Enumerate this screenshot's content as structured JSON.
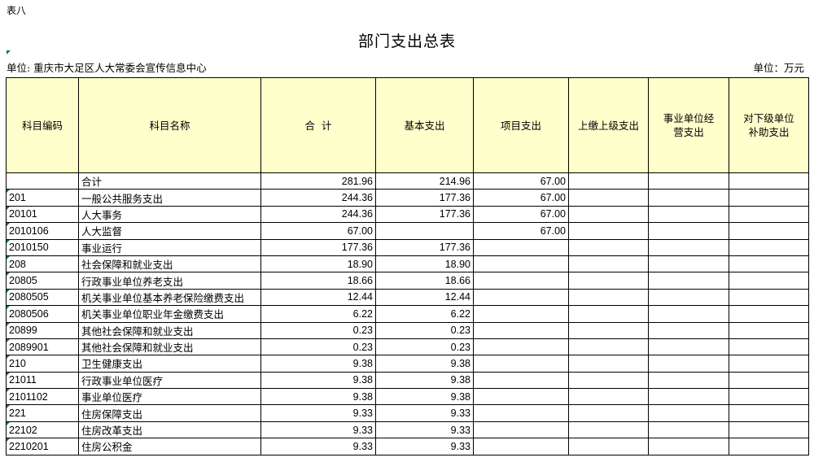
{
  "sheet_label": "表八",
  "title": "部门支出总表",
  "unit_left": "单位:  重庆市大足区人大常委会宣传信息中心",
  "unit_right": "单位：万元",
  "columns": [
    "科目编码",
    "科目名称",
    "合  计",
    "基本支出",
    "项目支出",
    "上缴上级支出",
    "事业单位经营支出",
    "对下级单位补助支出"
  ],
  "rows": [
    {
      "code": "",
      "name": "合计",
      "total": "281.96",
      "basic": "214.96",
      "project": "67.00",
      "upper": "",
      "business": "",
      "subsidy": ""
    },
    {
      "code": "201",
      "name": "一般公共服务支出",
      "total": "244.36",
      "basic": "177.36",
      "project": "67.00",
      "upper": "",
      "business": "",
      "subsidy": ""
    },
    {
      "code": "20101",
      "name": "人大事务",
      "total": "244.36",
      "basic": "177.36",
      "project": "67.00",
      "upper": "",
      "business": "",
      "subsidy": ""
    },
    {
      "code": "2010106",
      "name": "人大监督",
      "total": "67.00",
      "basic": "",
      "project": "67.00",
      "upper": "",
      "business": "",
      "subsidy": ""
    },
    {
      "code": "2010150",
      "name": "事业运行",
      "total": "177.36",
      "basic": "177.36",
      "project": "",
      "upper": "",
      "business": "",
      "subsidy": ""
    },
    {
      "code": "208",
      "name": "社会保障和就业支出",
      "total": "18.90",
      "basic": "18.90",
      "project": "",
      "upper": "",
      "business": "",
      "subsidy": ""
    },
    {
      "code": "20805",
      "name": "行政事业单位养老支出",
      "total": "18.66",
      "basic": "18.66",
      "project": "",
      "upper": "",
      "business": "",
      "subsidy": ""
    },
    {
      "code": "2080505",
      "name": "机关事业单位基本养老保险缴费支出",
      "total": "12.44",
      "basic": "12.44",
      "project": "",
      "upper": "",
      "business": "",
      "subsidy": ""
    },
    {
      "code": "2080506",
      "name": "机关事业单位职业年金缴费支出",
      "total": "6.22",
      "basic": "6.22",
      "project": "",
      "upper": "",
      "business": "",
      "subsidy": ""
    },
    {
      "code": "20899",
      "name": "其他社会保障和就业支出",
      "total": "0.23",
      "basic": "0.23",
      "project": "",
      "upper": "",
      "business": "",
      "subsidy": ""
    },
    {
      "code": "2089901",
      "name": "其他社会保障和就业支出",
      "total": "0.23",
      "basic": "0.23",
      "project": "",
      "upper": "",
      "business": "",
      "subsidy": ""
    },
    {
      "code": "210",
      "name": "卫生健康支出",
      "total": "9.38",
      "basic": "9.38",
      "project": "",
      "upper": "",
      "business": "",
      "subsidy": ""
    },
    {
      "code": "21011",
      "name": "行政事业单位医疗",
      "total": "9.38",
      "basic": "9.38",
      "project": "",
      "upper": "",
      "business": "",
      "subsidy": ""
    },
    {
      "code": "2101102",
      "name": "事业单位医疗",
      "total": "9.38",
      "basic": "9.38",
      "project": "",
      "upper": "",
      "business": "",
      "subsidy": ""
    },
    {
      "code": "221",
      "name": "住房保障支出",
      "total": "9.33",
      "basic": "9.33",
      "project": "",
      "upper": "",
      "business": "",
      "subsidy": ""
    },
    {
      "code": "22102",
      "name": "住房改革支出",
      "total": "9.33",
      "basic": "9.33",
      "project": "",
      "upper": "",
      "business": "",
      "subsidy": ""
    },
    {
      "code": "2210201",
      "name": "住房公积金",
      "total": "9.33",
      "basic": "9.33",
      "project": "",
      "upper": "",
      "business": "",
      "subsidy": ""
    }
  ],
  "colors": {
    "header_fill": "#ffffcc",
    "corner_mark": "#1a7a2e"
  }
}
